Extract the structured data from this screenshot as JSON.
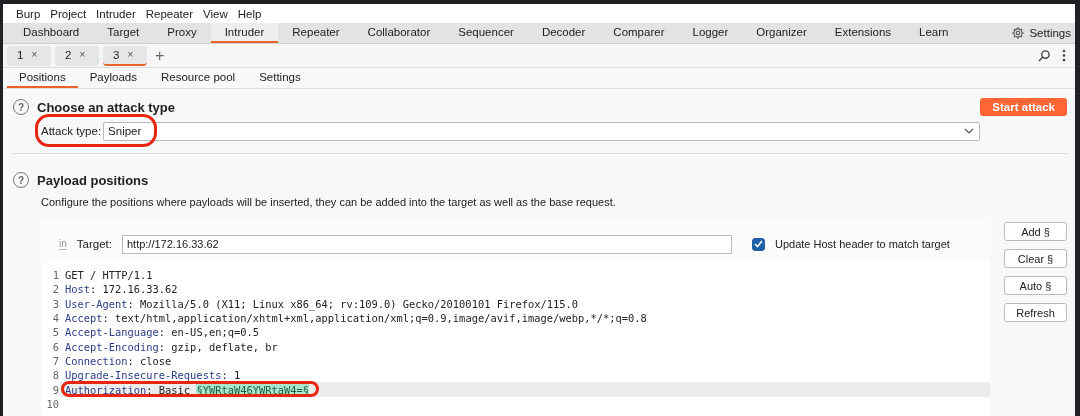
{
  "menu": [
    "Burp",
    "Project",
    "Intruder",
    "Repeater",
    "View",
    "Help"
  ],
  "main_tabs": [
    {
      "label": "Dashboard",
      "selected": false
    },
    {
      "label": "Target",
      "selected": false
    },
    {
      "label": "Proxy",
      "selected": false
    },
    {
      "label": "Intruder",
      "selected": true
    },
    {
      "label": "Repeater",
      "selected": false
    },
    {
      "label": "Collaborator",
      "selected": false
    },
    {
      "label": "Sequencer",
      "selected": false
    },
    {
      "label": "Decoder",
      "selected": false
    },
    {
      "label": "Comparer",
      "selected": false
    },
    {
      "label": "Logger",
      "selected": false
    },
    {
      "label": "Organizer",
      "selected": false
    },
    {
      "label": "Extensions",
      "selected": false
    },
    {
      "label": "Learn",
      "selected": false
    }
  ],
  "settings_label": "Settings",
  "instance_tabs": [
    {
      "label": "1",
      "close": "×",
      "selected": false
    },
    {
      "label": "2",
      "close": "×",
      "selected": false
    },
    {
      "label": "3",
      "close": "×",
      "selected": true
    }
  ],
  "add_tab": "+",
  "sub_tabs": [
    {
      "label": "Positions",
      "selected": true
    },
    {
      "label": "Payloads",
      "selected": false
    },
    {
      "label": "Resource pool",
      "selected": false
    },
    {
      "label": "Settings",
      "selected": false
    }
  ],
  "attack_section": {
    "help": "?",
    "title": "Choose an attack type",
    "start_button": "Start attack",
    "attack_type_label": "Attack type:",
    "attack_type_value": "Sniper",
    "highlighted": true
  },
  "positions_section": {
    "help": "?",
    "title": "Payload positions",
    "description": "Configure the positions where payloads will be inserted, they can be added into the target as well as the base request."
  },
  "target": {
    "icon_text": "in",
    "label": "Target:",
    "value": "http://172.16.33.62",
    "update_host_label": "Update Host header to match target",
    "update_host_checked": true
  },
  "side_buttons": [
    "Add §",
    "Clear §",
    "Auto §",
    "Refresh"
  ],
  "request_lines": [
    {
      "number": "1",
      "text": "GET / HTTP/1.1",
      "current": false,
      "highlighted": false
    },
    {
      "number": "2",
      "name": "Host",
      "text": ": 172.16.33.62",
      "current": false,
      "highlighted": false
    },
    {
      "number": "3",
      "name": "User-Agent",
      "text": ": Mozilla/5.0 (X11; Linux x86_64; rv:109.0) Gecko/20100101 Firefox/115.0",
      "current": false,
      "highlighted": false
    },
    {
      "number": "4",
      "name": "Accept",
      "text": ": text/html,application/xhtml+xml,application/xml;q=0.9,image/avif,image/webp,*/*;q=0.8",
      "current": false,
      "highlighted": false
    },
    {
      "number": "5",
      "name": "Accept-Language",
      "text": ": en-US,en;q=0.5",
      "current": false,
      "highlighted": false
    },
    {
      "number": "6",
      "name": "Accept-Encoding",
      "text": ": gzip, deflate, br",
      "current": false,
      "highlighted": false
    },
    {
      "number": "7",
      "name": "Connection",
      "text": ": close",
      "current": false,
      "highlighted": false
    },
    {
      "number": "8",
      "name": "Upgrade-Insecure-Requests",
      "text": ": 1",
      "current": false,
      "highlighted": false
    },
    {
      "number": "9",
      "name": "Authorization",
      "text": ": Basic ",
      "payload": "§YWRtaW46YWRtaW4=§",
      "current": true,
      "highlighted": true
    },
    {
      "number": "10",
      "current": false,
      "highlighted": false
    }
  ]
}
